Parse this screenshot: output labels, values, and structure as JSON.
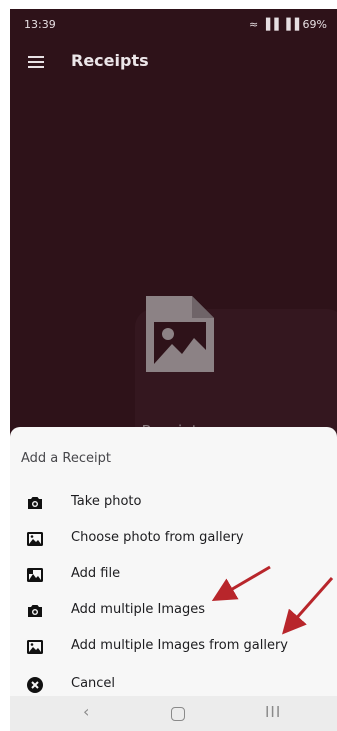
{
  "status": {
    "time": "13:39",
    "indicators": "≈ ▐▐ ▐▐ 69%"
  },
  "appbar": {
    "title": "Receipts",
    "menu_icon": "hamburger-icon"
  },
  "empty_state": {
    "label": "Receipts",
    "icon": "image-file-icon"
  },
  "sheet": {
    "title": "Add a Receipt",
    "items": [
      {
        "label": "Take photo",
        "icon": "camera-icon"
      },
      {
        "label": "Choose photo from gallery",
        "icon": "gallery-icon"
      },
      {
        "label": "Add file",
        "icon": "file-image-icon"
      },
      {
        "label": "Add multiple Images",
        "icon": "camera-icon"
      },
      {
        "label": "Add multiple Images from gallery",
        "icon": "gallery-icon"
      },
      {
        "label": "Cancel",
        "icon": "close-circle-icon"
      }
    ]
  },
  "navbar": {
    "back": "‹",
    "recent": "III"
  },
  "colors": {
    "background": "#2e1219",
    "sheet": "#f7f7f7",
    "annotation": "#b8262b"
  }
}
